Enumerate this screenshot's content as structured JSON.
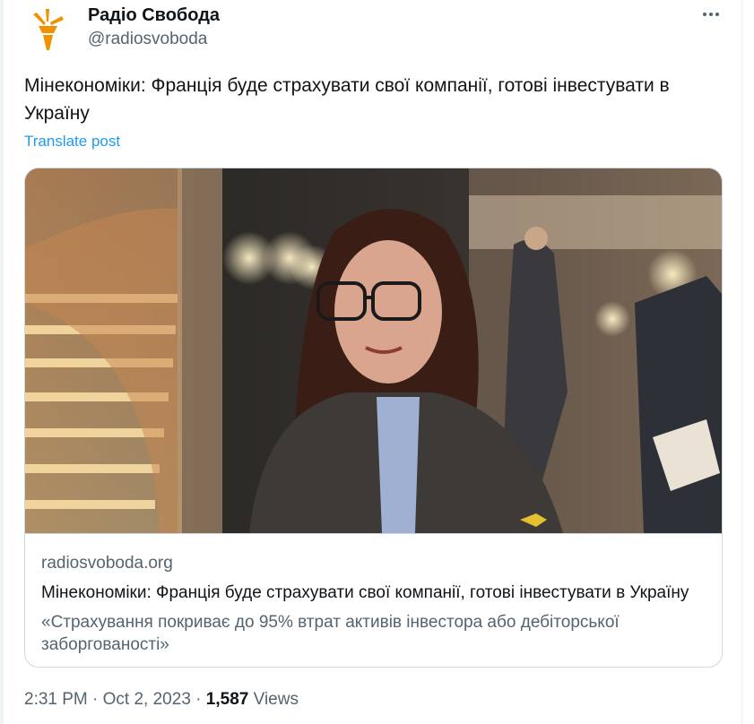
{
  "author": {
    "name": "Радіо Свобода",
    "handle": "@radiosvoboda",
    "avatar_icon": "radio-svoboda-torch-logo",
    "brand_color": "#f29100"
  },
  "tweet": {
    "text": "Мінекономіки: Франція буде страхувати свої компанії, готові інвестувати в Україну",
    "translate_label": "Translate post"
  },
  "card": {
    "domain": "radiosvoboda.org",
    "title": "Мінекономіки: Франція буде страхувати свої компанії, готові інвестувати в Україну",
    "description": "«Страхування покриває до 95% втрат активів інвестора або дебіторської заборгованості»"
  },
  "meta": {
    "time": "2:31 PM",
    "date": "Oct 2, 2023",
    "separator": "·",
    "views_count": "1,587",
    "views_label": "Views"
  },
  "icons": {
    "more": "more-options-icon"
  },
  "colors": {
    "link": "#1d9bf0",
    "secondary_text": "#536471",
    "border": "#cfd9de"
  }
}
